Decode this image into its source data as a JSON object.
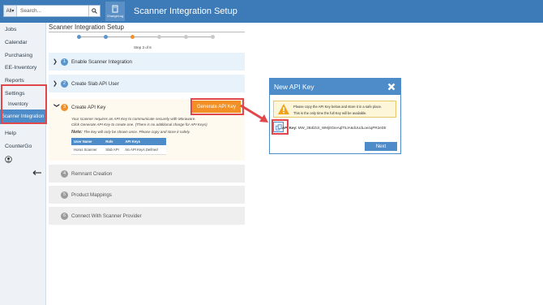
{
  "header": {
    "search_scope": "All",
    "search_placeholder": "Search...",
    "changelog_label": "ChangeLog",
    "app_title": "Scanner Integration Setup"
  },
  "sidebar": {
    "items": [
      {
        "label": "Jobs"
      },
      {
        "label": "Calendar"
      },
      {
        "label": "Purchasing"
      },
      {
        "label": "EE-Inventory"
      },
      {
        "label": "Reports"
      },
      {
        "label": "Settings"
      },
      {
        "label": "Inventory"
      },
      {
        "label": "Scanner Integration"
      },
      {
        "label": "Help"
      },
      {
        "label": "CounterGo"
      }
    ]
  },
  "main": {
    "title": "Scanner Integration Setup",
    "step_label": "Step 3 of 6",
    "steps": [
      {
        "num": "1",
        "label": "Enable Scanner Integration"
      },
      {
        "num": "2",
        "label": "Create Slab API User"
      },
      {
        "num": "3",
        "label": "Create API Key"
      },
      {
        "num": "4",
        "label": "Remnant Creation"
      },
      {
        "num": "5",
        "label": "Product Mappings"
      },
      {
        "num": "6",
        "label": "Connect With Scanner Provider"
      }
    ],
    "api_key_section": {
      "desc_line1": "Your scanner requires an API Key to communicate securely with Moraware.",
      "desc_line2": "Click Generate API Key to create one. (There is no additional charge for API Keys)",
      "note_label": "Note:",
      "note_text": "The key will only be shown once. Please copy and store it safely.",
      "generate_button": "Generate API Key",
      "table": {
        "headers": [
          "User Name",
          "Role",
          "API Keys"
        ],
        "row": [
          "Horus Scanner",
          "Slab API",
          "No API Keys Defined"
        ]
      }
    }
  },
  "modal": {
    "title": "New API Key",
    "warning_line1": "Please copy the API Key below and store it in a safe place.",
    "warning_line2": "This is the only time the full Key will be available.",
    "api_key_label": "API Key:",
    "api_key_value": "MW_2B4lZcit_WMj0GIeAqlT5JA6dUUdLoe4qPR2eDtr",
    "next_button": "Next"
  },
  "colors": {
    "primary": "#3d7ab8",
    "accent_orange": "#f29025",
    "highlight_red": "#e0464a"
  }
}
